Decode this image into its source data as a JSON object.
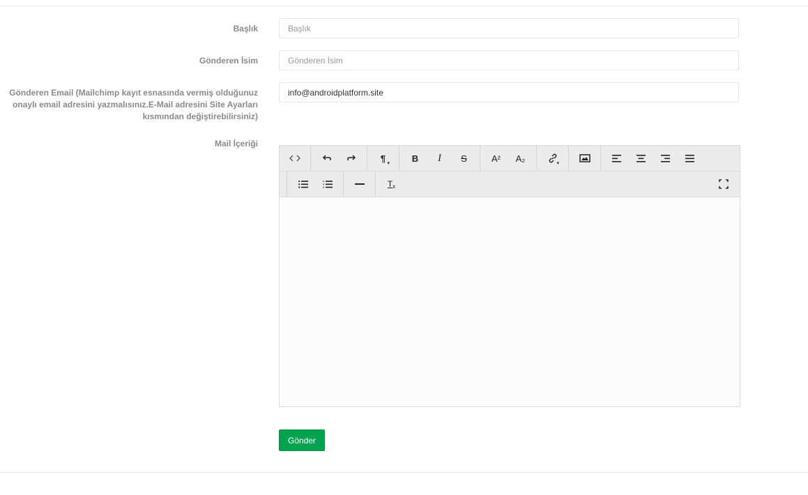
{
  "form": {
    "title_label": "Başlık",
    "title_placeholder": "Başlık",
    "sender_name_label": "Gönderen İsim",
    "sender_name_placeholder": "Gönderen İsim",
    "sender_email_label_line1": "Gönderen Email (Mailchimp kayıt esnasında vermiş olduğunuz",
    "sender_email_label_line2": "onaylı email adresini yazmalısınız.E-Mail adresini Site Ayarları",
    "sender_email_label_line3": "kısmından değiştirebilirsiniz)",
    "sender_email_value": "info@androidplatform.site",
    "content_label": "Mail İçeriği",
    "submit_label": "Gönder"
  },
  "toolbar": {
    "bold": "B",
    "italic": "I",
    "strikethrough": "S",
    "superscript": "A²",
    "subscript": "A₂",
    "paragraph": "¶",
    "clear_format": "T"
  },
  "colors": {
    "submit_bg": "#00a44e",
    "label": "#8a8a8a",
    "toolbar_bg": "#ebebeb"
  }
}
